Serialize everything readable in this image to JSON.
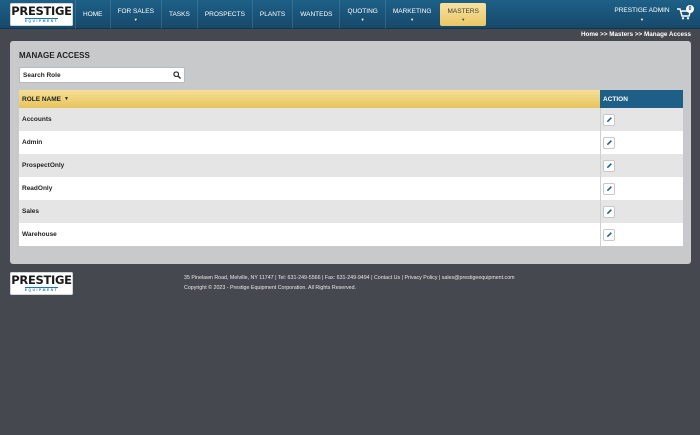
{
  "brand": {
    "name": "PRESTIGE",
    "sub": "EQUIPMENT"
  },
  "nav": [
    {
      "label": "HOME",
      "caret": false
    },
    {
      "label": "FOR SALES",
      "caret": true
    },
    {
      "label": "TASKS",
      "caret": false
    },
    {
      "label": "PROSPECTS",
      "caret": false
    },
    {
      "label": "PLANTS",
      "caret": false
    },
    {
      "label": "WANTEDS",
      "caret": false
    },
    {
      "label": "QUOTING",
      "caret": true
    },
    {
      "label": "MARKETING",
      "caret": true
    },
    {
      "label": "MASTERS",
      "caret": true,
      "active": true
    }
  ],
  "user": {
    "label": "PRESTIGE ADMIN"
  },
  "cart": {
    "count": "0"
  },
  "breadcrumb": {
    "home": "Home",
    "sep1": " >> ",
    "masters": "Masters",
    "sep2": " >> ",
    "current": "Manage Access"
  },
  "page": {
    "title": "MANAGE ACCESS"
  },
  "search": {
    "placeholder": "Search Role",
    "value": ""
  },
  "table": {
    "col_role": "ROLE NAME",
    "col_action": "ACTION",
    "rows": [
      "Accounts",
      "Admin",
      "ProspectOnly",
      "ReadOnly",
      "Sales",
      "Warehouse"
    ]
  },
  "footer": {
    "address": "35 Pinelawn Road, Melville, NY 11747 | Tel: 631-249-5566 | Fax: 631-249-9494 | ",
    "contact": "Contact Us",
    "sep1": " | ",
    "privacy": "Privacy Policy",
    "sep2": " | ",
    "email": "sales@prestigeequipment.com",
    "copyright": "Copyright © 2023 - Prestige Equipment Corporation. All Rights Reserved."
  },
  "colors": {
    "nav_blue": "#1e6088",
    "accent_gold": "#eac766",
    "action_blue": "#1e5f88",
    "background": "#45484f"
  }
}
